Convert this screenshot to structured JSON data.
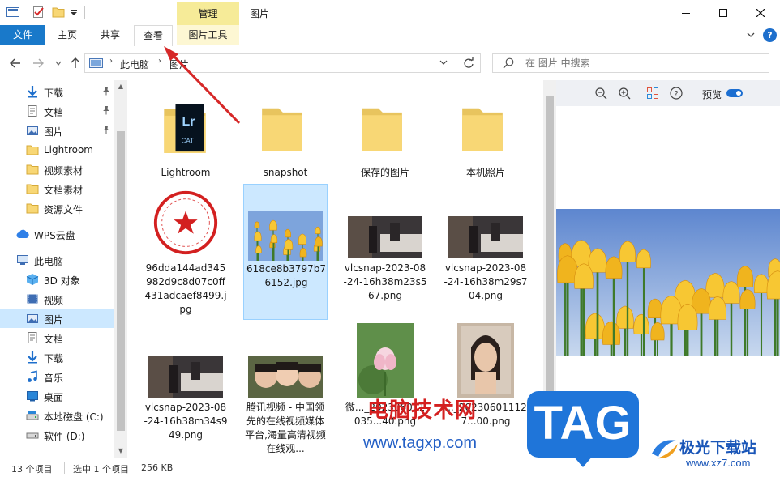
{
  "window": {
    "title": "图片",
    "context_tab_header": "管理"
  },
  "ribbon": {
    "tabs": [
      "文件",
      "主页",
      "共享",
      "查看",
      "图片工具"
    ]
  },
  "address": {
    "crumbs": [
      "此电脑",
      "图片"
    ],
    "search_placeholder": "在 图片 中搜索"
  },
  "nav": {
    "items": [
      {
        "label": "下载",
        "icon": "download-arrow-icon",
        "pinned": true
      },
      {
        "label": "文档",
        "icon": "document-icon",
        "pinned": true
      },
      {
        "label": "图片",
        "icon": "pictures-icon",
        "pinned": true
      },
      {
        "label": "Lightroom",
        "icon": "folder-icon",
        "pinned": false
      },
      {
        "label": "视频素材",
        "icon": "folder-icon",
        "pinned": false
      },
      {
        "label": "文档素材",
        "icon": "folder-icon",
        "pinned": false
      },
      {
        "label": "资源文件",
        "icon": "folder-icon",
        "pinned": false
      },
      {
        "label": "WPS云盘",
        "icon": "cloud-icon",
        "pinned": false
      },
      {
        "label": "此电脑",
        "icon": "computer-icon",
        "pinned": false
      },
      {
        "label": "3D 对象",
        "icon": "3d-objects-icon",
        "pinned": false
      },
      {
        "label": "视频",
        "icon": "video-icon",
        "pinned": false
      },
      {
        "label": "图片",
        "icon": "pictures-icon",
        "pinned": false,
        "selected": true
      },
      {
        "label": "文档",
        "icon": "document-icon",
        "pinned": false
      },
      {
        "label": "下载",
        "icon": "download-arrow-icon",
        "pinned": false
      },
      {
        "label": "音乐",
        "icon": "music-icon",
        "pinned": false
      },
      {
        "label": "桌面",
        "icon": "desktop-icon",
        "pinned": false
      },
      {
        "label": "本地磁盘 (C:)",
        "icon": "drive-c-icon",
        "pinned": false
      },
      {
        "label": "软件 (D:)",
        "icon": "drive-d-icon",
        "pinned": false
      }
    ]
  },
  "files": [
    {
      "name": "Lightroom",
      "kind": "folder-lr"
    },
    {
      "name": "snapshot",
      "kind": "folder"
    },
    {
      "name": "保存的图片",
      "kind": "folder"
    },
    {
      "name": "本机照片",
      "kind": "folder"
    },
    {
      "name": "96dda144ad345982d9c8d07c0ff431adcaef8499.jpg",
      "kind": "seal"
    },
    {
      "name": "618ce8b3797b76152.jpg",
      "kind": "tulip",
      "selected": true
    },
    {
      "name": "vlcsnap-2023-08-24-16h38m23s567.png",
      "kind": "video"
    },
    {
      "name": "vlcsnap-2023-08-24-16h38m29s704.png",
      "kind": "video"
    },
    {
      "name": "vlcsnap-2023-08-24-16h38m34s949.png",
      "kind": "video"
    },
    {
      "name": "腾讯视频 - 中国领先的在线视频媒体平台,海量高清视频在线观...",
      "kind": "tencent"
    },
    {
      "name": "微..._202306011035...40.png",
      "kind": "lotus"
    },
    {
      "name": "..._202306011127...00.png",
      "kind": "portrait"
    }
  ],
  "preview": {
    "label": "预览",
    "toggle_on": true
  },
  "status": {
    "item_count": "13 个项目",
    "selection": "选中 1 个项目",
    "size": "256 KB"
  },
  "watermarks": {
    "site_cn": "电脑技术网",
    "site_url": "www.tagxp.com",
    "tag_logo": "TAG",
    "jg_name": "极光下载站",
    "jg_url": "www.xz7.com"
  },
  "colors": {
    "accent": "#1979ca",
    "selection": "#cce8ff",
    "context_tab": "#f6eb98",
    "folder": "#f8d775",
    "annotation": "#d62828"
  }
}
